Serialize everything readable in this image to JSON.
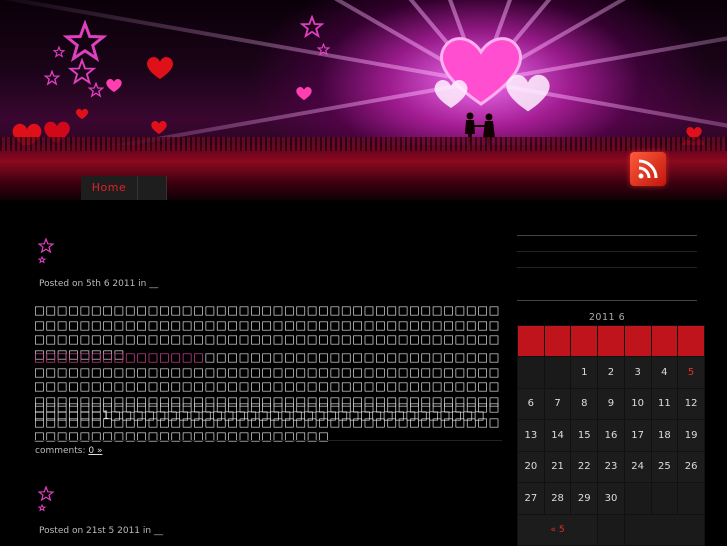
{
  "nav": {
    "home_label": "Home"
  },
  "posts": [
    {
      "meta": "Posted on 5th 6  2011 in __",
      "paragraphs": [
        "□□□□□□□□□□□□□□□□□□□□□□□□□□□□□□□□□□□□□□□□□□□□□□□□□□□□□□□□□□□□□□□□□□□□□□□□□□□□□□□□□□□□□□□□□□□□□□□□□□□□□□□□□□□□□□□□□□□□□□□□□□□□□□□□□□□",
        "□□□□□□□□□□□□□□□□□□□□□□□□□□□□□□□□□□□□□□□□□□□□□□□□□□□□□□□□□□□□□□□□□□□□□□□□□□□□□□□□□□□□□□□□□□□□□□□□□□□□□□□□□□□□□□□□□□□□□□□□□□□□□□□□□□□□□□□□□□□□□□□□□□□□□□□□□□□1□□□□□□□□□□□□□□□□□□□□□□□□□□□□□□□□□",
        "□□□□□□□□□□□□□□□□□□□□□□□□□□□□□□□□□□□□□□□□□□□□□□□□□□□□□□□□□□□□□□□□□□□□□□□□□□□□□□□□□□□□□□□□□□□□□□□□□□□□□□□□□□□□"
      ],
      "highlight": "□□□□□□□□□□□□□□□",
      "comments_label": "comments:",
      "comments_link": "0 »"
    },
    {
      "meta": "Posted on 21st 5  2011 in __"
    }
  ],
  "calendar": {
    "caption": "2011 6",
    "rows": [
      [
        "",
        "",
        "1",
        "2",
        "3",
        "4",
        "5"
      ],
      [
        "6",
        "7",
        "8",
        "9",
        "10",
        "11",
        "12"
      ],
      [
        "13",
        "14",
        "15",
        "16",
        "17",
        "18",
        "19"
      ],
      [
        "20",
        "21",
        "22",
        "23",
        "24",
        "25",
        "26"
      ],
      [
        "27",
        "28",
        "29",
        "30",
        "",
        "",
        ""
      ]
    ],
    "prev_link": "« 5"
  },
  "colors": {
    "accent_red": "#c0141c",
    "link_pink": "#e04aa0",
    "background": "#000000"
  }
}
